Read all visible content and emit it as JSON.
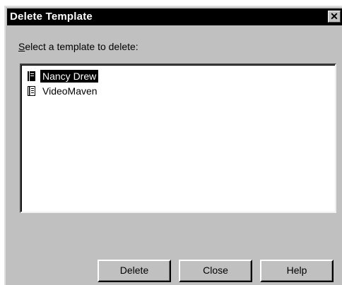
{
  "colors": {
    "titlebar_bg": "#000000",
    "titlebar_fg": "#ffffff",
    "dialog_bg": "#c0c0c0",
    "list_bg": "#ffffff",
    "selection_bg": "#000000"
  },
  "window": {
    "title": "Delete Template",
    "close_glyph": "✕"
  },
  "prompt": {
    "mnemonic": "S",
    "rest": "elect a template to delete:"
  },
  "list": {
    "items": [
      {
        "label": "Nancy Drew",
        "icon": "document-icon",
        "selected": true
      },
      {
        "label": "VideoMaven",
        "icon": "document-icon",
        "selected": false
      }
    ]
  },
  "buttons": {
    "delete": "Delete",
    "close": "Close",
    "help": "Help"
  }
}
